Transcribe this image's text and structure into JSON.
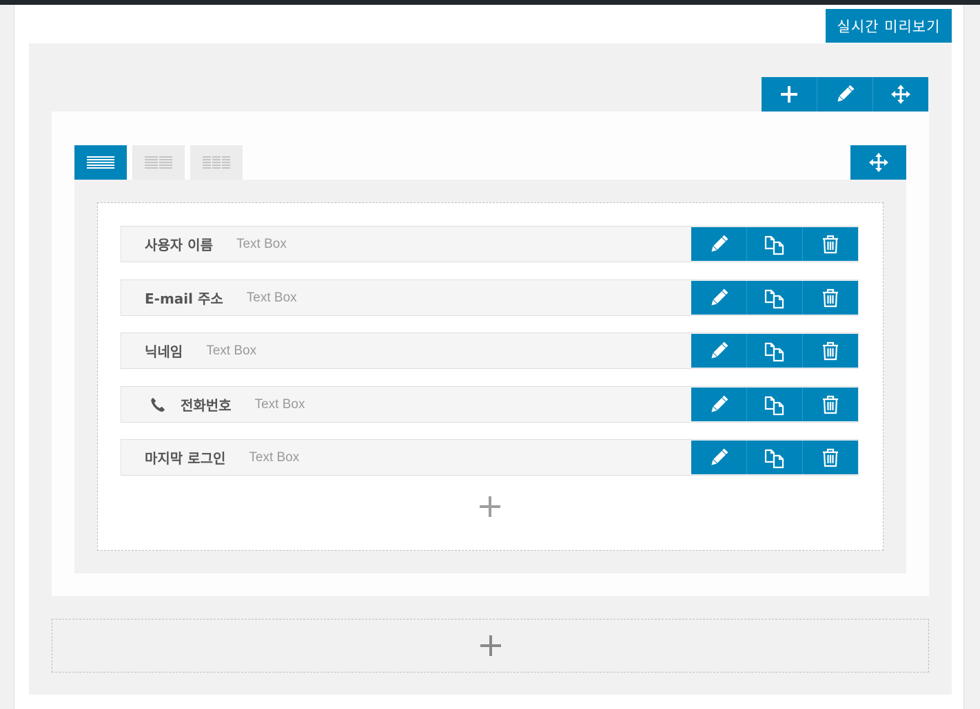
{
  "header": {
    "preview_label": "실시간 미리보기"
  },
  "section_toolbar": {
    "icons": [
      "plus-icon",
      "pencil-icon",
      "move-arrows-icon"
    ]
  },
  "layout_tabs": [
    "one-column-layout",
    "two-column-layout",
    "three-column-layout"
  ],
  "fields": [
    {
      "label": "사용자 이름",
      "type": "Text Box",
      "icon": null
    },
    {
      "label": "E-mail 주소",
      "type": "Text Box",
      "icon": null
    },
    {
      "label": "닉네임",
      "type": "Text Box",
      "icon": null
    },
    {
      "label": "전화번호",
      "type": "Text Box",
      "icon": "phone-icon"
    },
    {
      "label": "마지막 로그인",
      "type": "Text Box",
      "icon": null
    }
  ],
  "field_actions": [
    "edit",
    "duplicate",
    "delete"
  ],
  "colors": {
    "accent": "#0085ba",
    "canvas": "#f1f1f1",
    "field_bg": "#f5f5f5"
  }
}
